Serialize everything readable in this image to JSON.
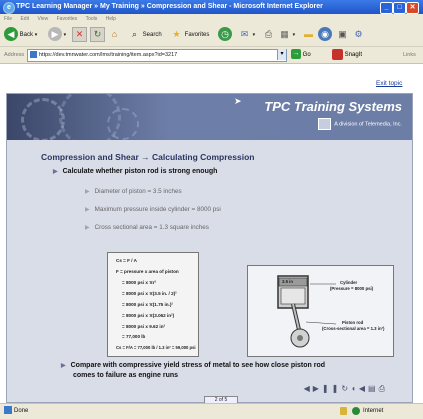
{
  "window": {
    "title": "TPC Learning Manager » My Training » Compression and Shear - Microsoft Internet Explorer",
    "min_glyph": "_",
    "max_glyph": "□",
    "close_glyph": "✕"
  },
  "menu": [
    "File",
    "Edit",
    "View",
    "Favorites",
    "Tools",
    "Help"
  ],
  "toolbar": {
    "back_label": "Back",
    "search_label": "Search",
    "favorites_label": "Favorites"
  },
  "address": {
    "label": "Address",
    "url": "https://dev.tmnwater.com/lms/training/item.aspx?id=3217",
    "go_label": "Go",
    "snagit_label": "SnagIt",
    "links_label": "Links"
  },
  "page": {
    "exit_label": "Exit topic",
    "brand": "TPC Training Systems",
    "brand_sub": "A division of Telemedia, Inc.",
    "slide_title": "Compression and Shear → Calculating Compression",
    "bullet1": "Calculate whether piston rod is strong enough",
    "sub1": "Diameter of piston = 3.5 inches",
    "sub2": "Maximum pressure inside cylinder = 8000 psi",
    "sub3": "Cross sectional area = 1.3 square inches",
    "bullet2_line1": "Compare with compressive yield stress of metal to see how close piston rod",
    "bullet2_line2": "comes to failure as engine runs",
    "formula": {
      "l1": "Cs = F / A",
      "l2": "F  = pressure x area of piston",
      "l3": "= 8000 psi x πr²",
      "l4": "= 8000 psi x π(3.5 in. / 2)²",
      "l5": "= 8000 psi x π(1.75 in.)²",
      "l6": "= 8000 psi x π(3.062 in²)",
      "l7": "= 8000 psi x 9.62 in²",
      "l8": "= 77,000 lb",
      "l9": "Cs = F/A = 77,000 lb / 1.3 in² = 59,000 psi"
    },
    "diagram": {
      "dim_label": "3.5 in",
      "cylinder_label": "Cylinder",
      "cylinder_pressure": "(Pressure = 8000 psi)",
      "rod_label": "Piston rod",
      "rod_area": "(Cross-sectional area = 1.3 in²)"
    },
    "page_indicator": "2 of 5"
  },
  "status": {
    "text": "Done",
    "zone": "Internet"
  },
  "colors": {
    "title_bar": "#1f55c8",
    "slide_header": "#3b4769",
    "slide_title": "#2a3560",
    "slide_bg": "#d9dde7"
  }
}
